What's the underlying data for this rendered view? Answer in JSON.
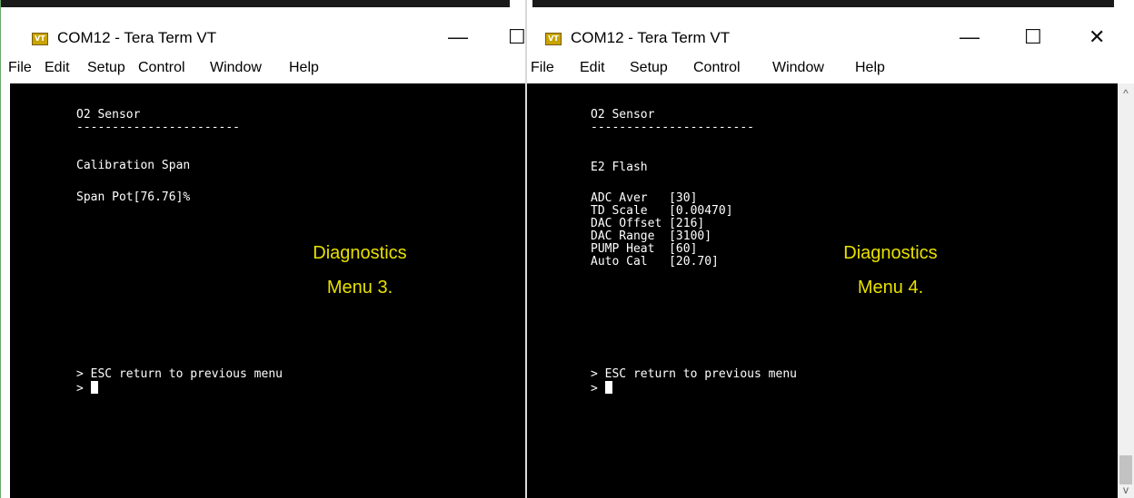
{
  "left_window": {
    "title": "COM12 - Tera Term VT",
    "app_icon": "VT",
    "controls": {
      "minimize": "—",
      "maximize": "☐"
    },
    "menu": [
      "File",
      "Edit",
      "Setup",
      "Control",
      "Window",
      "Help"
    ],
    "terminal_lines": {
      "l1": "O2 Sensor",
      "l2": "-----------------------",
      "l3": "Calibration Span",
      "l4": "Span Pot[76.76]%",
      "l5": "> ESC return to previous menu",
      "prompt": ">"
    },
    "overlay": {
      "line1": "Diagnostics",
      "line2": "Menu 3."
    }
  },
  "right_window": {
    "title": "COM12 - Tera Term VT",
    "app_icon": "VT",
    "controls": {
      "minimize": "—",
      "maximize": "☐",
      "close": "✕"
    },
    "menu": [
      "File",
      "Edit",
      "Setup",
      "Control",
      "Window",
      "Help"
    ],
    "terminal_lines": {
      "l1": "O2 Sensor",
      "l2": "-----------------------",
      "l3": "E2 Flash",
      "params": [
        "ADC Aver   [30]",
        "TD Scale   [0.00470]",
        "DAC Offset [216]",
        "DAC Range  [3100]",
        "PUMP Heat  [60]",
        "Auto Cal   [20.70]"
      ],
      "l5": "> ESC return to previous menu",
      "prompt": ">"
    },
    "overlay": {
      "line1": "Diagnostics",
      "line2": "Menu 4."
    },
    "scrollbar": {
      "up_icon": "^",
      "down_icon": "v"
    }
  }
}
